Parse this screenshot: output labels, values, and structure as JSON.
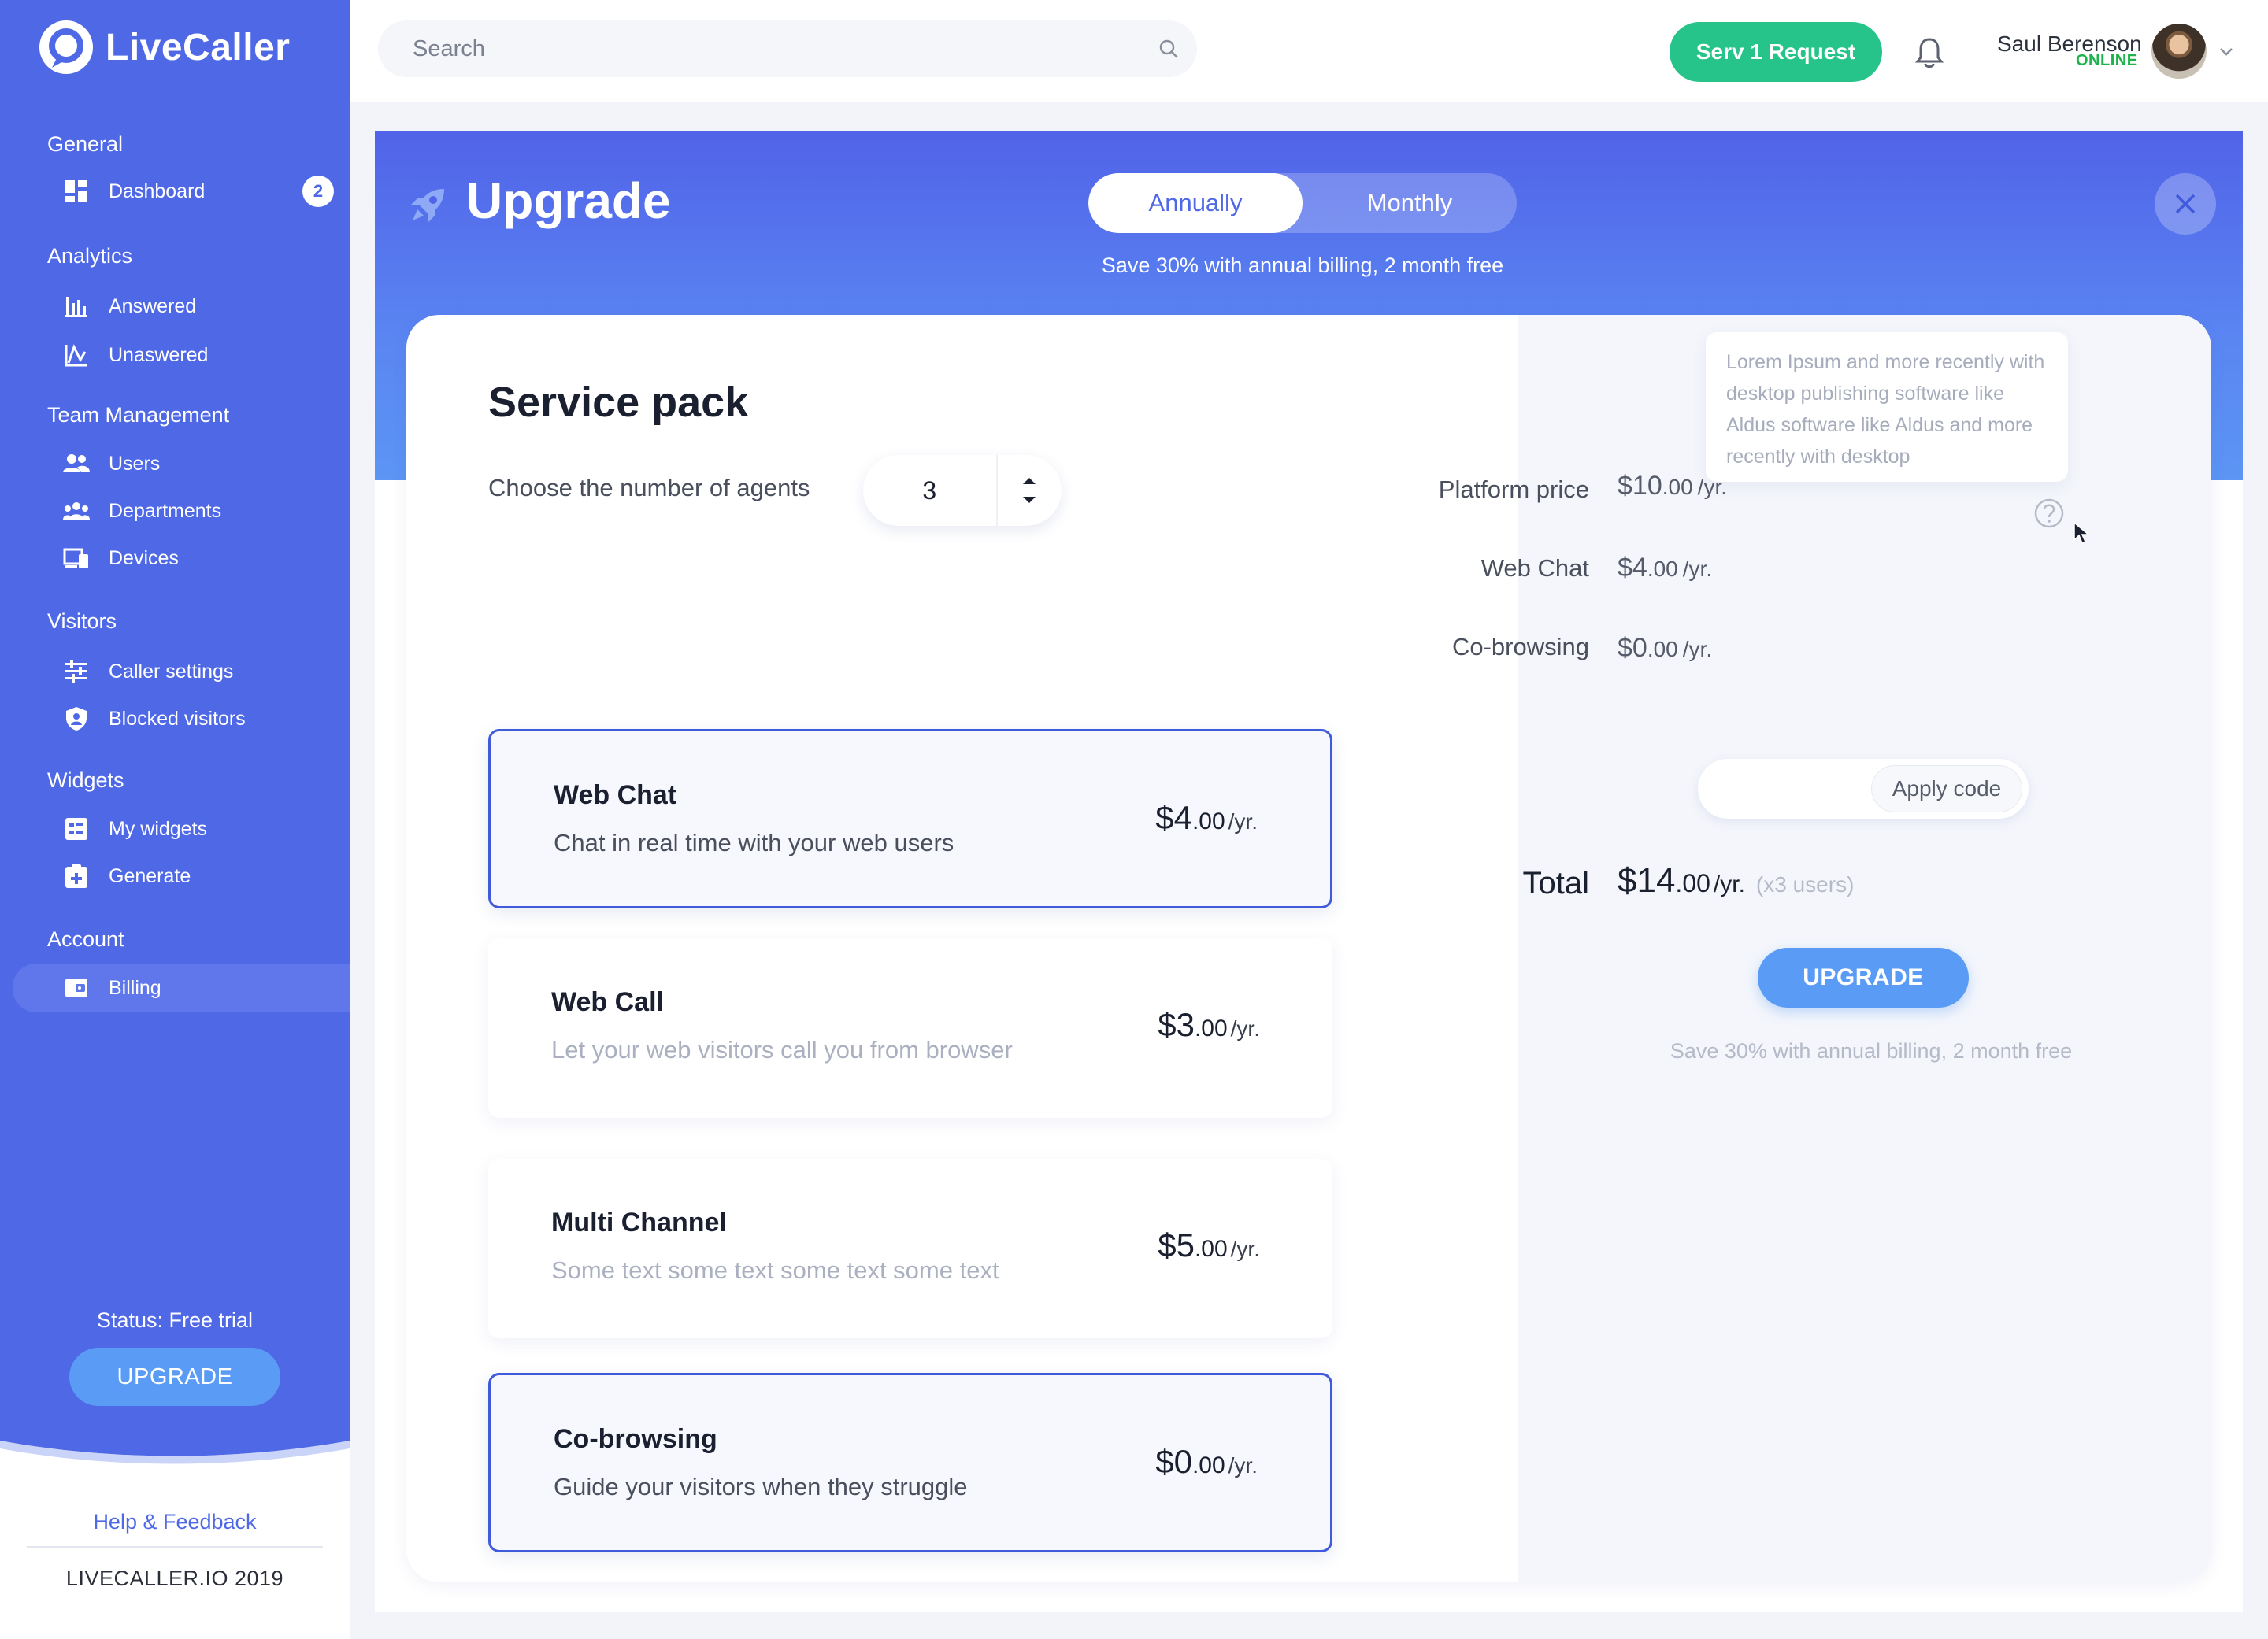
{
  "brand": {
    "name": "LiveCaller"
  },
  "sidebar": {
    "groups": [
      {
        "title": "General",
        "items": [
          {
            "label": "Dashboard",
            "icon": "dashboard-icon",
            "badge": "2"
          }
        ]
      },
      {
        "title": "Analytics",
        "items": [
          {
            "label": "Answered",
            "icon": "bar-chart-icon"
          },
          {
            "label": "Unaswered",
            "icon": "line-chart-icon"
          }
        ]
      },
      {
        "title": "Team Management",
        "items": [
          {
            "label": "Users",
            "icon": "users-icon"
          },
          {
            "label": "Departments",
            "icon": "departments-icon"
          },
          {
            "label": "Devices",
            "icon": "devices-icon"
          }
        ]
      },
      {
        "title": "Visitors",
        "items": [
          {
            "label": "Caller settings",
            "icon": "sliders-icon"
          },
          {
            "label": "Blocked visitors",
            "icon": "shield-icon"
          }
        ]
      },
      {
        "title": "Widgets",
        "items": [
          {
            "label": "My widgets",
            "icon": "widgets-icon"
          },
          {
            "label": "Generate",
            "icon": "generate-icon"
          }
        ]
      },
      {
        "title": "Account",
        "items": [
          {
            "label": "Billing",
            "icon": "wallet-icon",
            "active": true
          }
        ]
      }
    ],
    "status": "Status: Free trial",
    "upgrade_label": "UPGRADE",
    "help_label": "Help & Feedback",
    "copyright": "LIVECALLER.IO  2019"
  },
  "topbar": {
    "search_placeholder": "Search",
    "request_label": "Serv 1 Request",
    "user": {
      "name": "Saul Berenson",
      "status": "ONLINE"
    }
  },
  "upgrade": {
    "title": "Upgrade",
    "billing_options": [
      "Annually",
      "Monthly"
    ],
    "selected_billing": "Annually",
    "billing_note": "Save 30% with annual billing, 2 month free",
    "service_pack_title": "Service pack",
    "agents_label": "Choose the number of agents",
    "agents_value": "3",
    "packs": [
      {
        "name": "Web Chat",
        "desc": "Chat in real time with your web users",
        "dollars": "$4",
        "cents": ".00",
        "per": "/yr.",
        "selected": true
      },
      {
        "name": "Web Call",
        "desc": "Let your web visitors call you from browser",
        "dollars": "$3",
        "cents": ".00",
        "per": "/yr.",
        "selected": false
      },
      {
        "name": "Multi Channel",
        "desc": "Some text some text some text some text",
        "dollars": "$5",
        "cents": ".00",
        "per": "/yr.",
        "selected": false
      },
      {
        "name": "Co-browsing",
        "desc": "Guide your visitors when they struggle",
        "dollars": "$0",
        "cents": ".00",
        "per": "/yr.",
        "selected": true
      }
    ],
    "tooltip": "Lorem Ipsum and more recently with desktop publishing software like Aldus software like Aldus and more recently with desktop",
    "summary": [
      {
        "label": "Platform price",
        "dollars": "$10",
        "cents": ".00",
        "per": "/yr."
      },
      {
        "label": "Web Chat",
        "dollars": "$4",
        "cents": ".00",
        "per": "/yr."
      },
      {
        "label": "Co-browsing",
        "dollars": "$0",
        "cents": ".00",
        "per": "/yr."
      }
    ],
    "apply_label": "Apply code",
    "total_label": "Total",
    "total": {
      "dollars": "$14",
      "cents": ".00",
      "per": "/yr.",
      "users": "(x3 users)"
    },
    "upgrade_label": "UPGRADE",
    "footer_note": "Save 30% with annual billing, 2 month free"
  },
  "colors": {
    "sidebar": "#4f69e6",
    "accent_green": "#26c48b",
    "button_blue": "#5a9cf5",
    "online": "#1bb34a"
  }
}
